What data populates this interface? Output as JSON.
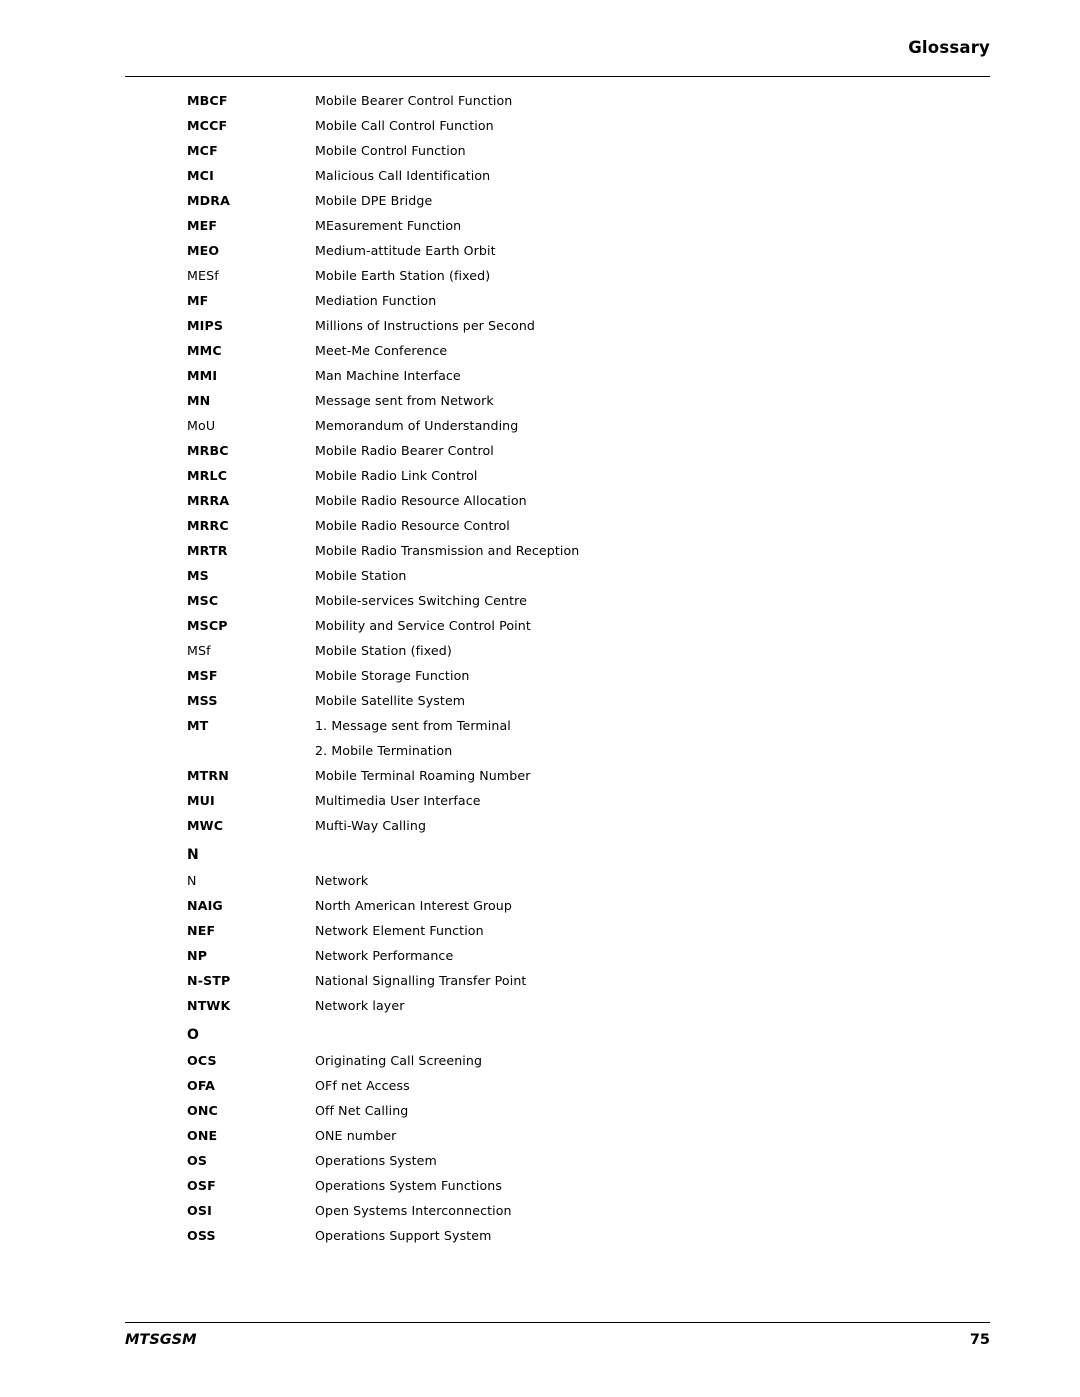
{
  "header": {
    "title": "Glossary"
  },
  "footer": {
    "doc_name": "MTSGSM",
    "page_number": "75"
  },
  "entries": [
    {
      "term": "MBCF",
      "bold": true,
      "definition": "Mobile Bearer Control Function"
    },
    {
      "term": "MCCF",
      "bold": true,
      "definition": "Mobile Call Control Function"
    },
    {
      "term": "MCF",
      "bold": true,
      "definition": "Mobile Control Function"
    },
    {
      "term": "MCI",
      "bold": true,
      "definition": "Malicious Call Identification"
    },
    {
      "term": "MDRA",
      "bold": true,
      "definition": "Mobile DPE Bridge"
    },
    {
      "term": "MEF",
      "bold": true,
      "definition": "MEasurement  Function"
    },
    {
      "term": "MEO",
      "bold": true,
      "definition": "Medium-attitude Earth Orbit"
    },
    {
      "term": "MESf",
      "bold": false,
      "definition": "Mobile Earth Station (fixed)"
    },
    {
      "term": "MF",
      "bold": true,
      "definition": "Mediation Function"
    },
    {
      "term": "MIPS",
      "bold": true,
      "definition": "Millions of Instructions per Second"
    },
    {
      "term": "MMC",
      "bold": true,
      "definition": "Meet-Me Conference"
    },
    {
      "term": "MMI",
      "bold": true,
      "definition": "Man Machine Interface"
    },
    {
      "term": "MN",
      "bold": true,
      "definition": "Message sent from Network"
    },
    {
      "term": "MoU",
      "bold": false,
      "definition": "Memorandum of Understanding"
    },
    {
      "term": "MRBC",
      "bold": true,
      "definition": "Mobile Radio Bearer Control"
    },
    {
      "term": "MRLC",
      "bold": true,
      "definition": "Mobile Radio Link Control"
    },
    {
      "term": "MRRA",
      "bold": true,
      "definition": "Mobile Radio Resource Allocation"
    },
    {
      "term": "MRRC",
      "bold": true,
      "definition": "Mobile Radio Resource Control"
    },
    {
      "term": "MRTR",
      "bold": true,
      "definition": "Mobile Radio Transmission and Reception"
    },
    {
      "term": "MS",
      "bold": true,
      "definition": "Mobile Station"
    },
    {
      "term": "MSC",
      "bold": true,
      "definition": "Mobile-services Switching Centre"
    },
    {
      "term": "MSCP",
      "bold": true,
      "definition": "Mobility and Service Control Point"
    },
    {
      "term": "MSf",
      "bold": false,
      "definition": "Mobile Station (fixed)"
    },
    {
      "term": "MSF",
      "bold": true,
      "definition": "Mobile Storage Function"
    },
    {
      "term": "MSS",
      "bold": true,
      "definition": "Mobile Satellite System"
    },
    {
      "term": "MT",
      "bold": true,
      "definition": "1. Message sent from Terminal",
      "definition2": "2. Mobile Termination"
    },
    {
      "term": "MTRN",
      "bold": true,
      "definition": "Mobile Terminal Roaming Number"
    },
    {
      "term": "MUI",
      "bold": true,
      "definition": "Multimedia User Interface"
    },
    {
      "term": "MWC",
      "bold": true,
      "definition": "Mufti-Way Calling"
    }
  ],
  "section_n": {
    "letter": "N",
    "entries": [
      {
        "term": "N",
        "bold": false,
        "definition": "Network"
      },
      {
        "term": "NAIG",
        "bold": true,
        "definition": "North American Interest Group"
      },
      {
        "term": "NEF",
        "bold": true,
        "definition": "Network Element Function"
      },
      {
        "term": "NP",
        "bold": true,
        "definition": "Network Performance"
      },
      {
        "term": "N-STP",
        "bold": true,
        "definition": "National Signalling Transfer Point"
      },
      {
        "term": "NTWK",
        "bold": true,
        "definition": "Network layer"
      }
    ]
  },
  "section_o": {
    "letter": "O",
    "entries": [
      {
        "term": "OCS",
        "bold": true,
        "definition": "Originating Call Screening"
      },
      {
        "term": "OFA",
        "bold": true,
        "definition": "OFf net Access"
      },
      {
        "term": "ONC",
        "bold": true,
        "definition": "Off Net Calling"
      },
      {
        "term": "ONE",
        "bold": true,
        "definition": "ONE number"
      },
      {
        "term": "OS",
        "bold": true,
        "definition": "Operations System"
      },
      {
        "term": "OSF",
        "bold": true,
        "definition": "Operations System Functions"
      },
      {
        "term": "OSI",
        "bold": true,
        "definition": "Open Systems Interconnection"
      },
      {
        "term": "OSS",
        "bold": true,
        "definition": "Operations Support System"
      }
    ]
  }
}
